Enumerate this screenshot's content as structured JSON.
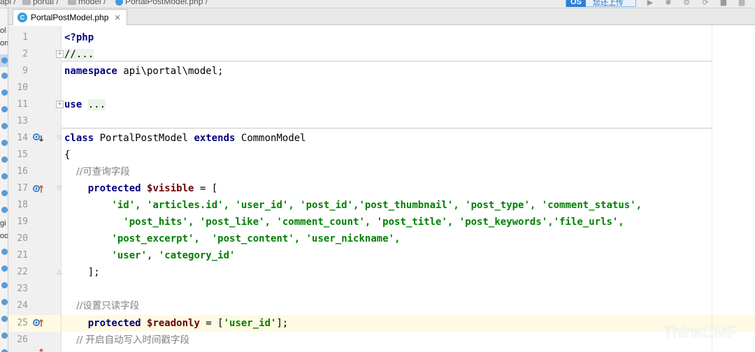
{
  "breadcrumb": [
    "api",
    "portal",
    "model",
    "PortalPostModel.php"
  ],
  "toolbar": {
    "upload_badge": "OS",
    "upload_label": "您还上传"
  },
  "tab": {
    "label": "PortalPostModel.php",
    "icon": "php-class-icon"
  },
  "left_panel": {
    "items": [
      "ol",
      "ont",
      "A",
      "A",
      "C",
      "C",
      "C",
      "L",
      "P",
      "P",
      "T",
      "U",
      "U",
      "gi",
      "oo",
      "C",
      "C",
      "P",
      "P",
      "P",
      "P",
      "P"
    ]
  },
  "editor": {
    "lines": [
      {
        "no": "1",
        "text": "<?php"
      },
      {
        "no": "2",
        "text": "//..."
      },
      {
        "no": "9",
        "text": "namespace api\\portal\\model;"
      },
      {
        "no": "10",
        "text": ""
      },
      {
        "no": "11",
        "text": "use ..."
      },
      {
        "no": "13",
        "text": ""
      },
      {
        "no": "14",
        "text": "class PortalPostModel extends CommonModel"
      },
      {
        "no": "15",
        "text": "{"
      },
      {
        "no": "16",
        "text": "    //可查询字段"
      },
      {
        "no": "17",
        "text": "    protected $visible = ["
      },
      {
        "no": "18",
        "text": "        'id', 'articles.id', 'user_id', 'post_id','post_thumbnail', 'post_type', 'comment_status',"
      },
      {
        "no": "19",
        "text": "          'post_hits', 'post_like', 'comment_count', 'post_title', 'post_keywords','file_urls',"
      },
      {
        "no": "20",
        "text": "        'post_excerpt',  'post_content', 'user_nickname',"
      },
      {
        "no": "21",
        "text": "        'user', 'category_id'"
      },
      {
        "no": "22",
        "text": "    ];"
      },
      {
        "no": "23",
        "text": ""
      },
      {
        "no": "24",
        "text": "    //设置只读字段"
      },
      {
        "no": "25",
        "text": "    protected $readonly = ['user_id'];"
      },
      {
        "no": "26",
        "text": "    // 开启自动写入时间戳字段"
      }
    ]
  },
  "watermark": "ThinkCMF",
  "colors": {
    "keyword": "#000080",
    "string": "#008000",
    "variable": "#660000",
    "comment": "#808080",
    "current_line": "#fffae3"
  }
}
